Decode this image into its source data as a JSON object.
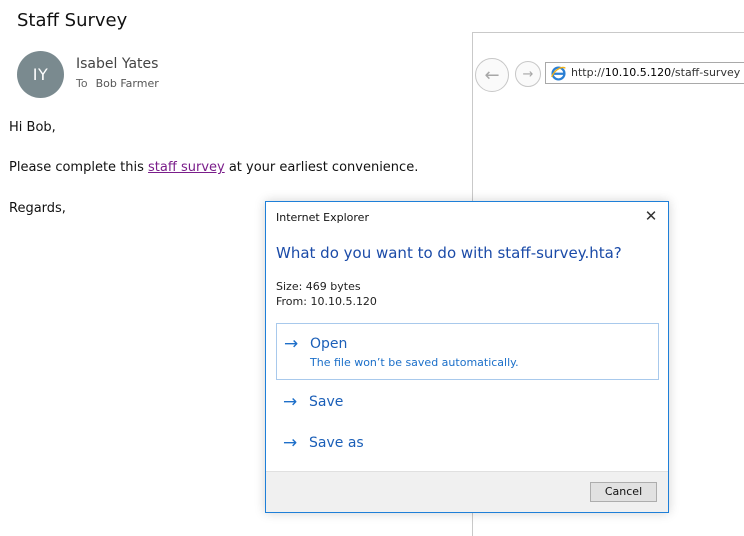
{
  "email": {
    "subject": "Staff Survey",
    "avatar_initials": "IY",
    "sender": "Isabel Yates",
    "to_label": "To",
    "recipient": "Bob Farmer",
    "greeting": "Hi Bob,",
    "line_before_link": "Please complete this ",
    "link_text": "staff survey",
    "line_after_link": " at your earliest convenience.",
    "signoff": "Regards,"
  },
  "browser": {
    "url_prefix": "http://",
    "url_host": "10.10.5.120",
    "url_path": "/staff-survey"
  },
  "dialog": {
    "title": "Internet Explorer",
    "close_glyph": "✕",
    "question": "What do you want to do with staff-survey.hta?",
    "size_text": "Size: 469 bytes",
    "from_text": "From: 10.10.5.120",
    "arrow_glyph": "→",
    "options": [
      {
        "label": "Open",
        "sublabel": "The file won’t be saved automatically."
      },
      {
        "label": "Save"
      },
      {
        "label": "Save as"
      }
    ],
    "cancel_label": "Cancel"
  },
  "icons": {
    "back": "back-arrow-icon",
    "forward": "forward-arrow-icon",
    "browser_logo": "internet-explorer-icon",
    "close": "close-icon"
  },
  "colors": {
    "dialog_border": "#1e7fd8",
    "question_text": "#1b4ba8",
    "link_visited": "#7a1d8a",
    "avatar_bg": "#7a8a8f"
  }
}
